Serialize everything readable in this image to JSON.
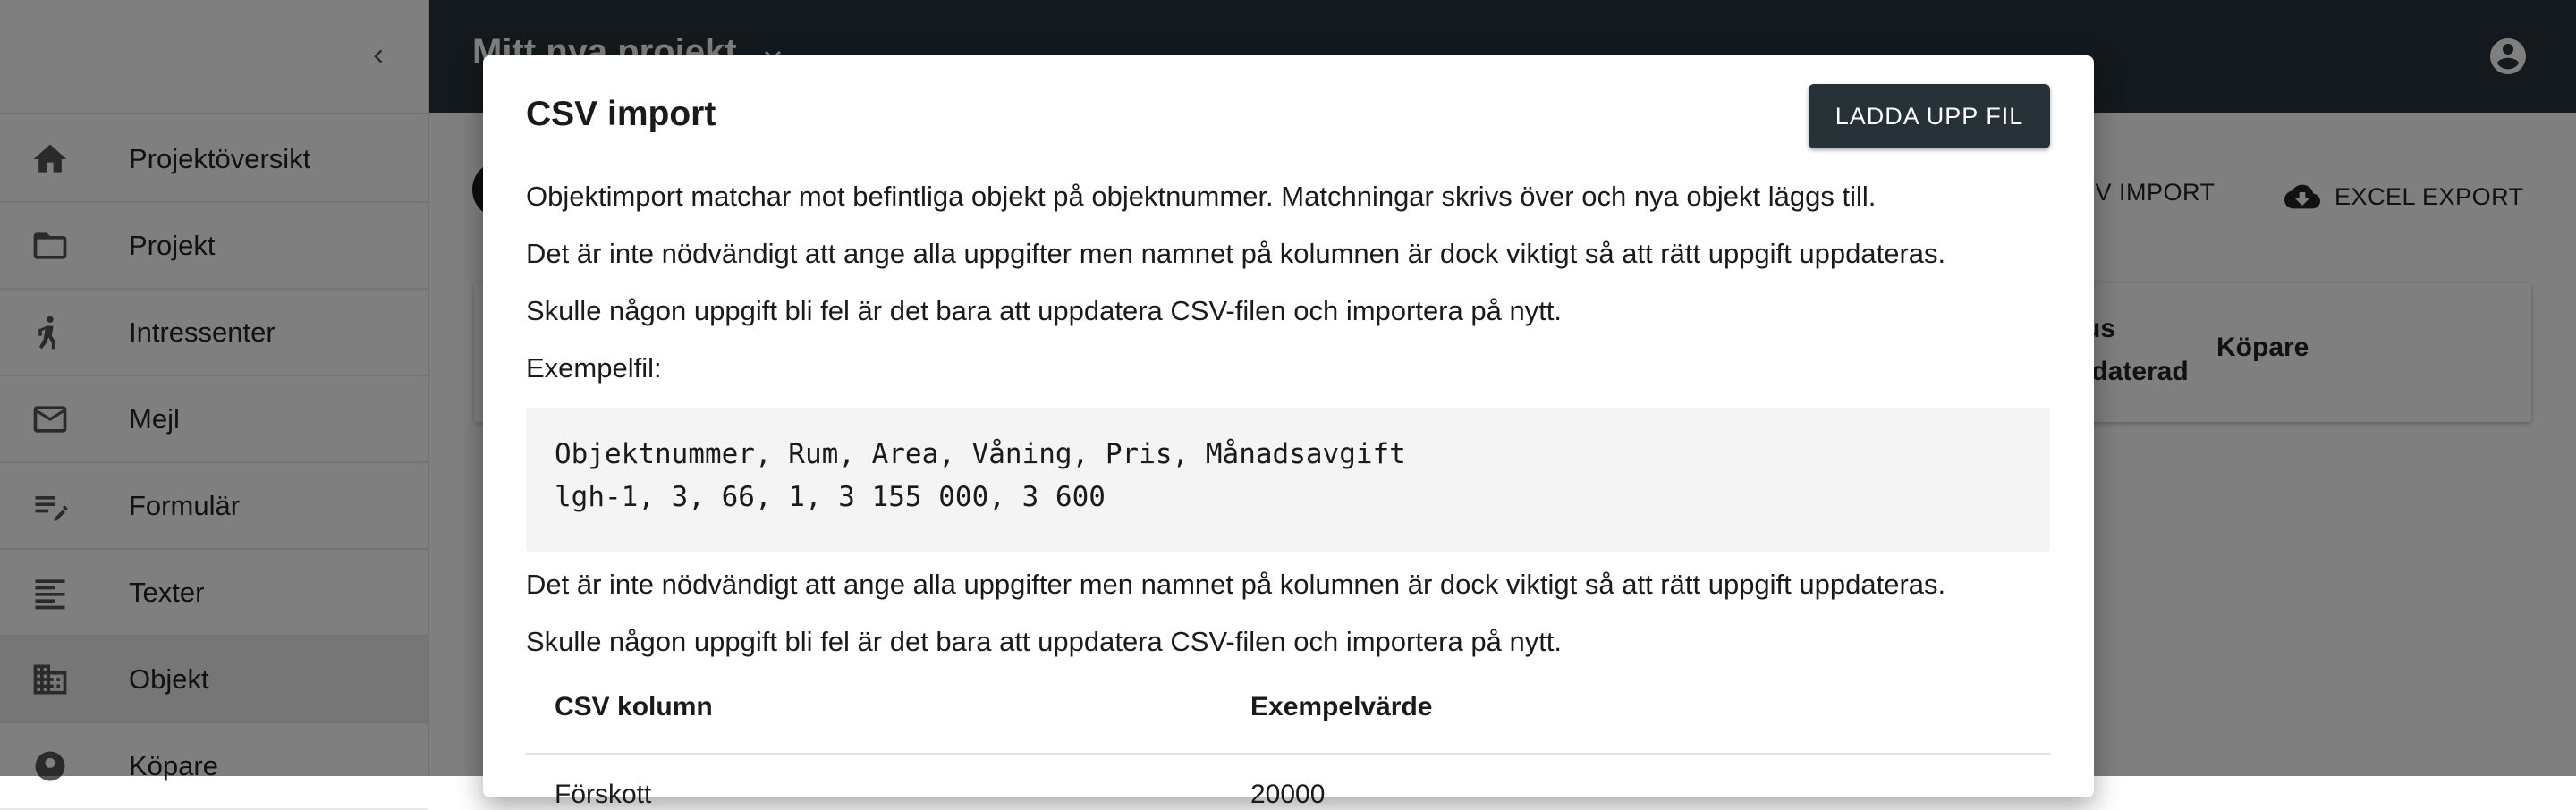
{
  "sidebar": {
    "items": [
      {
        "label": "Projektöversikt",
        "icon": "home-icon"
      },
      {
        "label": "Projekt",
        "icon": "folder-icon"
      },
      {
        "label": "Intressenter",
        "icon": "person-walking-icon"
      },
      {
        "label": "Mejl",
        "icon": "mail-icon"
      },
      {
        "label": "Formulär",
        "icon": "form-edit-icon"
      },
      {
        "label": "Texter",
        "icon": "text-lines-icon"
      },
      {
        "label": "Objekt",
        "icon": "building-icon"
      },
      {
        "label": "Köpare",
        "icon": "buyer-icon"
      }
    ],
    "active_item": "Objekt"
  },
  "topbar": {
    "project_name": "Mitt nya projekt"
  },
  "toolbar": {
    "csv_import_label": "CSV IMPORT",
    "excel_export_label": "EXCEL EXPORT"
  },
  "table": {
    "status_header_line1": "tus",
    "status_header_line2": "pdaterad",
    "buyer_header": "Köpare"
  },
  "dialog": {
    "title": "CSV import",
    "upload_button": "LADDA UPP FIL",
    "paragraph_1": "Objektimport matchar mot befintliga objekt på objektnummer. Matchningar skrivs över och nya objekt läggs till.",
    "paragraph_2": "Det är inte nödvändigt att ange alla uppgifter men namnet på kolumnen är dock viktigt så att rätt uppgift uppdateras.",
    "paragraph_3": "Skulle någon uppgift bli fel är det bara att uppdatera CSV-filen och importera på nytt.",
    "example_label": "Exempelfil:",
    "code_line_1": "Objektnummer, Rum, Area, Våning, Pris, Månadsavgift",
    "code_line_2": "lgh-1, 3, 66, 1, 3 155 000, 3 600",
    "paragraph_4": "Det är inte nödvändigt att ange alla uppgifter men namnet på kolumnen är dock viktigt så att rätt uppgift uppdateras.",
    "paragraph_5": "Skulle någon uppgift bli fel är det bara att uppdatera CSV-filen och importera på nytt.",
    "table": {
      "columns": [
        "CSV kolumn",
        "Exempelvärde"
      ],
      "rows": [
        [
          "Förskott",
          "20000"
        ]
      ]
    }
  },
  "colors": {
    "topbar": "#263238",
    "button": "#263238",
    "code_bg": "#f4f4f4"
  }
}
